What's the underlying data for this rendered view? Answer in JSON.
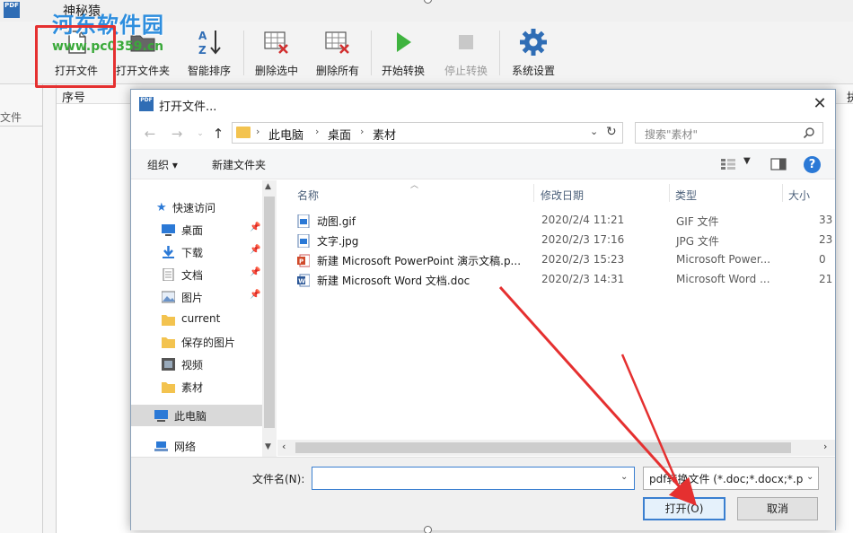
{
  "app": {
    "title": "神秘猿",
    "logo_text": "PDF"
  },
  "watermark": {
    "line1": "河东软件园",
    "line2": "www.pc0359.cn"
  },
  "ribbon": {
    "items": [
      {
        "label": "打开文件",
        "icon": "open-file-icon",
        "enabled": true
      },
      {
        "label": "打开文件夹",
        "icon": "open-folder-icon",
        "enabled": true
      },
      {
        "label": "智能排序",
        "icon": "sort-az-icon",
        "enabled": true
      },
      {
        "label": "删除选中",
        "icon": "delete-selected-icon",
        "enabled": true
      },
      {
        "label": "删除所有",
        "icon": "delete-all-icon",
        "enabled": true
      },
      {
        "label": "开始转换",
        "icon": "play-icon",
        "enabled": true
      },
      {
        "label": "停止转换",
        "icon": "stop-icon",
        "enabled": false
      },
      {
        "label": "系统设置",
        "icon": "gear-icon",
        "enabled": true
      }
    ]
  },
  "left_panel": {
    "label": "文件"
  },
  "list": {
    "columns": [
      "序号",
      "执"
    ]
  },
  "dialog": {
    "title": "打开文件...",
    "icon_text": "PDF",
    "breadcrumb": [
      "此电脑",
      "桌面",
      "素材"
    ],
    "search_placeholder": "搜索\"素材\"",
    "organize_label": "组织 ▾",
    "new_folder_label": "新建文件夹",
    "help_label": "?",
    "nav": {
      "quick_access": "快速访问",
      "items": [
        {
          "label": "桌面",
          "icon": "desktop-icon",
          "pinned": true
        },
        {
          "label": "下载",
          "icon": "download-icon",
          "pinned": true
        },
        {
          "label": "文档",
          "icon": "document-icon",
          "pinned": true
        },
        {
          "label": "图片",
          "icon": "pictures-icon",
          "pinned": true
        },
        {
          "label": "current",
          "icon": "folder-icon",
          "pinned": false
        },
        {
          "label": "保存的图片",
          "icon": "folder-icon",
          "pinned": false
        },
        {
          "label": "视频",
          "icon": "video-icon",
          "pinned": false
        },
        {
          "label": "素材",
          "icon": "folder-icon",
          "pinned": false
        }
      ],
      "this_pc": "此电脑",
      "network": "网络"
    },
    "file_columns": {
      "name": "名称",
      "date": "修改日期",
      "type": "类型",
      "size": "大小"
    },
    "files": [
      {
        "name": "动图.gif",
        "date": "2020/2/4 11:21",
        "type": "GIF 文件",
        "size": "33",
        "icon": "image-file-icon"
      },
      {
        "name": "文字.jpg",
        "date": "2020/2/3 17:16",
        "type": "JPG 文件",
        "size": "23",
        "icon": "image-file-icon"
      },
      {
        "name": "新建 Microsoft PowerPoint 演示文稿.p...",
        "date": "2020/2/3 15:23",
        "type": "Microsoft Power...",
        "size": "0",
        "icon": "powerpoint-file-icon"
      },
      {
        "name": "新建 Microsoft Word 文档.doc",
        "date": "2020/2/3 14:31",
        "type": "Microsoft Word ...",
        "size": "21",
        "icon": "word-file-icon"
      }
    ],
    "filename_label": "文件名(N):",
    "filename_value": "",
    "filter_value": "pdf转换文件 (*.doc;*.docx;*.p",
    "open_label": "打开(O)",
    "cancel_label": "取消",
    "close_label": "✕"
  },
  "colors": {
    "accent": "#3a7fd0",
    "highlight_red": "#e53030",
    "folder": "#f3c34f"
  }
}
